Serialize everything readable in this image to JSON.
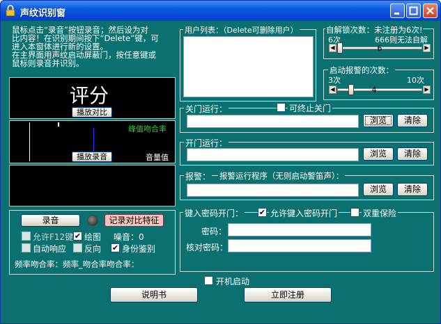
{
  "window": {
    "title": "声纹识别窗"
  },
  "info_text": [
    "鼠标点击“录音”按钮录音；然后设为对",
    "比内容！在识别期间按下“Delete”键，可",
    "进入本窗体进行新的设置。",
    "在主界面用声纹启动屏蔽门，按任意键或",
    "鼠标则录音并识别。"
  ],
  "score_panel": {
    "score_label": "评分",
    "compare_button": "播放对比"
  },
  "wave_panel": {
    "peak_label": "峰值吻合率",
    "play_button": "播放录音",
    "volume_label": "音量值"
  },
  "controls": {
    "record_button": "录音",
    "record_compare_button": "记录对比特征",
    "allow_f12": {
      "label": "允许F12键",
      "checked": false
    },
    "draw": {
      "label": "绘图",
      "checked": true
    },
    "noise": "噪音：0",
    "auto_response": {
      "label": "自动响应",
      "checked": false
    },
    "reverse": {
      "label": "反向",
      "checked": false
    },
    "identity": {
      "label": "身份鉴别",
      "checked": true
    },
    "freq_text": "频率吻合率：频率_吻合率吻合率："
  },
  "user_list": {
    "label": "用户列表：（Delete可删除用户）"
  },
  "lock_times": {
    "label": "自解锁次数：未注册为6次!",
    "min_label": "6次",
    "max_label": "666则无法自解",
    "value": "6",
    "fraction": 0.0
  },
  "alarm_times": {
    "label": "启动报警的次数：",
    "min_label": "3次",
    "max_label": "10次",
    "value": "4",
    "fraction": 0.14
  },
  "close_door": {
    "label": "关门运行：",
    "terminable_label": "可终止关门",
    "terminable_checked": false,
    "browse": "浏览",
    "clear": "清除"
  },
  "open_door": {
    "label": "开门运行：",
    "browse": "浏览",
    "clear": "清除"
  },
  "alarm": {
    "label": "报警：",
    "sub_label": "报警运行程序（无则启动警笛声）：",
    "browse": "浏览",
    "clear": "清除"
  },
  "password": {
    "group_label": "键入密码开门：",
    "allow_label": "允许键入密码开门",
    "allow_checked": true,
    "double_label": "双重保险",
    "double_checked": false,
    "password_label": "密码：",
    "confirm_label": "核对密码："
  },
  "footer": {
    "autostart_label": "开机启动",
    "autostart_checked": false,
    "manual_button": "说明书",
    "register_button": "立即注册"
  },
  "colors": {
    "background": "#0b7070",
    "accent_text": "#2fd42f"
  }
}
